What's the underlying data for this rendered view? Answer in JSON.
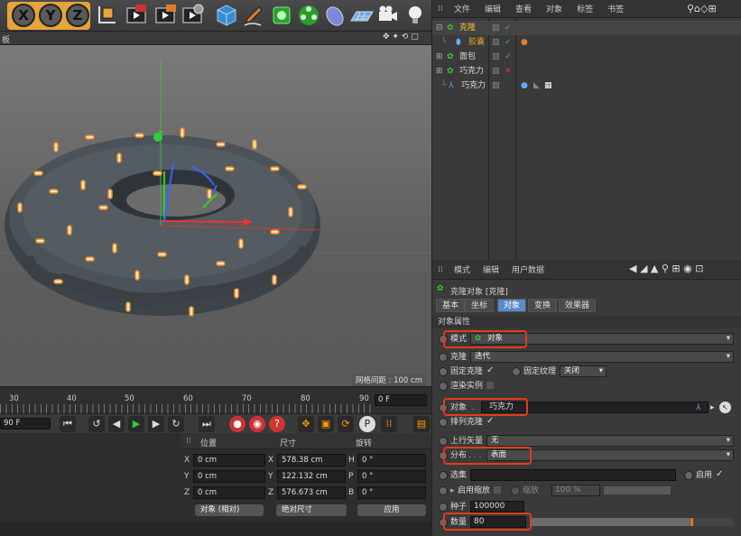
{
  "toolbar": {
    "axes": [
      "X",
      "Y",
      "Z"
    ]
  },
  "viewport": {
    "head_label": "板",
    "grid_info": "网格间距 : 100 cm"
  },
  "timeline": {
    "ticks": [
      "30",
      "40",
      "50",
      "60",
      "70",
      "80",
      "90"
    ],
    "frame_field": "0 F",
    "left_field": "90 F"
  },
  "coords": {
    "headers": {
      "position": "位置",
      "size": "尺寸",
      "rotation": "旋转"
    },
    "rows": [
      {
        "axis": "X",
        "pos": "0 cm",
        "size_axis": "X",
        "size": "578.38 cm",
        "rot_axis": "H",
        "rot": "0 °"
      },
      {
        "axis": "Y",
        "pos": "0 cm",
        "size_axis": "Y",
        "size": "122.132 cm",
        "rot_axis": "P",
        "rot": "0 °"
      },
      {
        "axis": "Z",
        "pos": "0 cm",
        "size_axis": "Z",
        "size": "576.673 cm",
        "rot_axis": "B",
        "rot": "0 °"
      }
    ],
    "mode_select": "对象 (相对)",
    "size_select": "绝对尺寸",
    "apply": "应用"
  },
  "object_manager": {
    "menu": [
      "文件",
      "编辑",
      "查看",
      "对象",
      "标签",
      "书签"
    ],
    "objects": [
      {
        "name": "克隆",
        "color": "#f0c040"
      },
      {
        "name": "胶囊",
        "color": "#e0a030"
      },
      {
        "name": "面包",
        "color": "#dddddd"
      },
      {
        "name": "巧克力",
        "color": "#dddddd"
      },
      {
        "name": "巧克力",
        "color": "#dddddd"
      }
    ]
  },
  "attributes": {
    "menu": [
      "模式",
      "编辑",
      "用户数据"
    ],
    "object_title": "克隆对象 [克隆]",
    "tabs": [
      "基本",
      "坐标",
      "对象",
      "变换",
      "效果器"
    ],
    "selected_tab": "对象",
    "section": "对象属性",
    "mode_label": "模式",
    "mode_value": "对象",
    "clone_label": "克隆",
    "clone_value": "迭代",
    "fixed_clone": "固定克隆",
    "fixed_texture": "固定纹理",
    "fixed_texture_value": "关闭",
    "render_instances": "渲染实例",
    "object_label": "对象",
    "object_value": "巧克力",
    "arrange_clones": "排列克隆",
    "up_vector": "上行矢量",
    "up_vector_value": "无",
    "distribution": "分布",
    "distribution_value": "表面",
    "selection": "选集",
    "enable": "启用",
    "enable_scale": "启用缩放",
    "scale": "缩放",
    "scale_value": "100 %",
    "seed": "种子",
    "seed_value": "100000",
    "count": "数量",
    "count_value": "80"
  }
}
